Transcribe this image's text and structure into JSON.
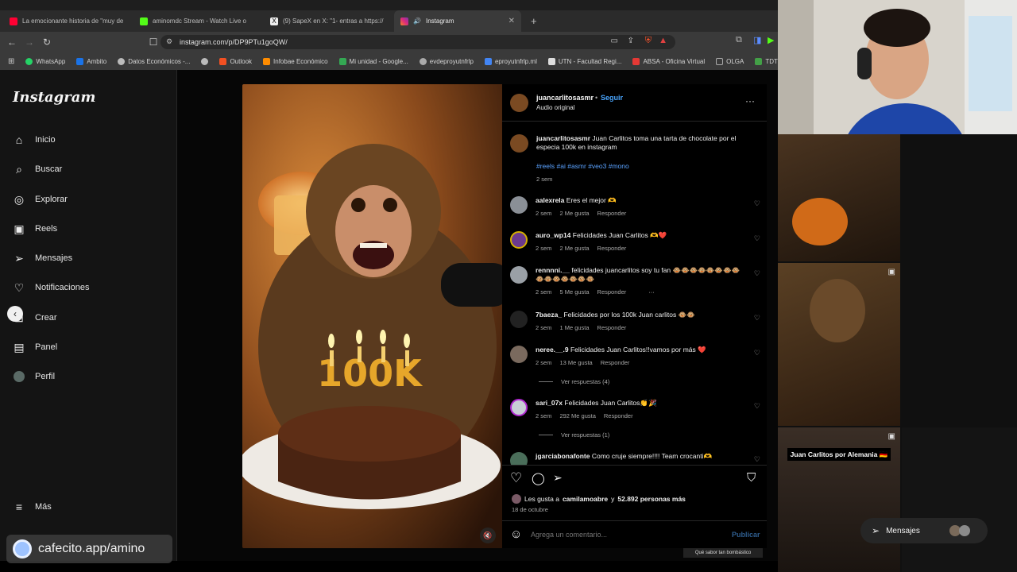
{
  "browser": {
    "tabs": [
      {
        "label": "La emocionante historia de \"muy de",
        "icon": "youtube-icon",
        "color": "#ff0033"
      },
      {
        "label": "aminomdc Stream - Watch Live o",
        "icon": "kick-icon",
        "color": "#53fc18"
      },
      {
        "label": "(9) SapeX en X: \"1- entras a https://",
        "icon": "x-icon",
        "color": "#000000"
      },
      {
        "label": "Instagram",
        "icon": "instagram-icon",
        "color": "#e1306c"
      }
    ],
    "new_tab": "+",
    "url": "instagram.com/p/DP9PTu1goQW/",
    "bookmarks": [
      {
        "label": "WhatsApp",
        "color": "#25d366"
      },
      {
        "label": "Ambito",
        "color": "#1a73e8"
      },
      {
        "label": "Datos Económicos -...",
        "color": "#bbbbbb"
      },
      {
        "label": "",
        "color": "#bbbbbb"
      },
      {
        "label": "Outlook",
        "color": "#f25022"
      },
      {
        "label": "Infobae Económico",
        "color": "#ff8c00"
      },
      {
        "label": "Mi unidad - Google...",
        "color": "#34a853"
      },
      {
        "label": "evdeproyutnfrlp",
        "color": "#aaaaaa"
      },
      {
        "label": "eproyutnfrlp.ml",
        "color": "#4285f4"
      },
      {
        "label": "UTN - Facultad Regi...",
        "color": "#dddddd"
      },
      {
        "label": "ABSA - Oficina Virtual",
        "color": "#e53935"
      },
      {
        "label": "OLGA",
        "color": "#aaaaaa"
      },
      {
        "label": "TDT -",
        "color": "#43a047"
      }
    ]
  },
  "sidebar": {
    "logo": "Instagram",
    "items": [
      {
        "label": "Inicio",
        "icon": "home-icon"
      },
      {
        "label": "Buscar",
        "icon": "search-icon"
      },
      {
        "label": "Explorar",
        "icon": "compass-icon"
      },
      {
        "label": "Reels",
        "icon": "reels-icon"
      },
      {
        "label": "Mensajes",
        "icon": "send-icon"
      },
      {
        "label": "Notificaciones",
        "icon": "heart-icon"
      },
      {
        "label": "Crear",
        "icon": "plus-icon"
      },
      {
        "label": "Panel",
        "icon": "chart-icon"
      },
      {
        "label": "Perfil",
        "icon": "avatar-icon"
      }
    ],
    "more": "Más"
  },
  "post": {
    "author": "juancarlitosasmr",
    "follow": "Seguir",
    "audio": "Audio original",
    "caption_user": "juancarlitosasmr",
    "caption_text": "Juan Carlitos toma una tarta de chocolate por el especia 100k en instagram",
    "hashtags": "#reels #ai #asmr #veo3 #mono",
    "caption_time": "2 sem",
    "image_text": "100K",
    "comments": [
      {
        "user": "aalexrela",
        "text": "Eres el mejor 🫶",
        "time": "2 sem",
        "likes": "2 Me gusta",
        "reply": "Responder",
        "avatar": "#8a8f96"
      },
      {
        "user": "auro_wp14",
        "text": "Felicidades Juan Carlitos 🫶❤️",
        "time": "2 sem",
        "likes": "2 Me gusta",
        "reply": "Responder",
        "avatar": "#6b3a8e"
      },
      {
        "user": "rennnni.__",
        "text": "felicidades juancarlitos soy tu fan 🐵🐵🐵🐵🐵🐵🐵🐵🐵🐵🐵🐵🐵🐵🐵",
        "time": "2 sem",
        "likes": "5 Me gusta",
        "reply": "Responder",
        "more": "···",
        "avatar": "#9aa0a6"
      },
      {
        "user": "7baeza_",
        "text": "Felicidades por los 100k Juan carlitos 🐵🐵",
        "time": "2 sem",
        "likes": "1 Me gusta",
        "reply": "Responder",
        "avatar": "#222222"
      },
      {
        "user": "neree.__.9",
        "text": "Felicidades Juan Carlitos!!vamos por más ❤️",
        "time": "2 sem",
        "likes": "13 Me gusta",
        "reply": "Responder",
        "avatar": "#7a6a5e"
      },
      {
        "user": "sari_07x",
        "text": "Felicidades Juan Carlitos👏🎉",
        "time": "2 sem",
        "likes": "292 Me gusta",
        "reply": "Responder",
        "avatar": "#c8ced6"
      },
      {
        "user": "jgarciabonafonte",
        "text": "Como cruje siempre!!!! Team crocanti🫶",
        "time": "",
        "likes": "",
        "reply": "",
        "avatar": "#4a6e5a"
      }
    ],
    "view_replies": [
      "Ver respuestas (4)",
      "Ver respuestas (1)"
    ],
    "likes_prefix": "Les gusta a",
    "likes_user": "camilamoabre",
    "likes_and": "y",
    "likes_count": "52.892 personas más",
    "date": "18 de octubre",
    "comment_placeholder": "Agrega un comentario...",
    "publish": "Publicar"
  },
  "right": {
    "banner": "Juan Carlitos por Alemania 🇩🇪",
    "bottom_text": "Qué sabor tan bombástico"
  },
  "overlay_badge": "cafecito.app/amino",
  "messages_button": "Mensajes"
}
